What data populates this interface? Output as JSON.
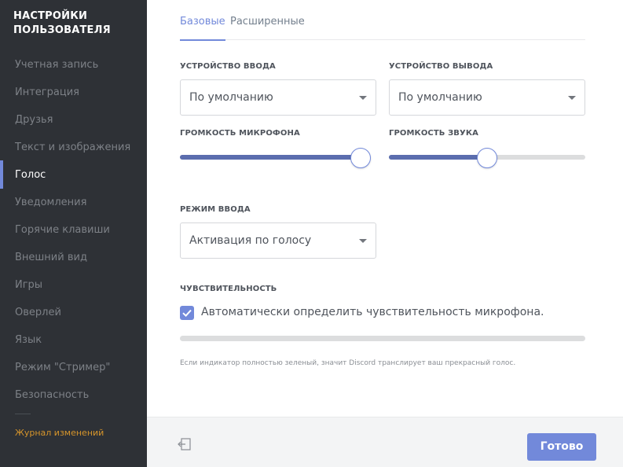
{
  "sidebar": {
    "title_line1": "НАСТРОЙКИ",
    "title_line2": "ПОЛЬЗОВАТЕЛЯ",
    "items": [
      {
        "label": "Учетная запись"
      },
      {
        "label": "Интеграция"
      },
      {
        "label": "Друзья"
      },
      {
        "label": "Текст и изображения"
      },
      {
        "label": "Голос"
      },
      {
        "label": "Уведомления"
      },
      {
        "label": "Горячие клавиши"
      },
      {
        "label": "Внешний вид"
      },
      {
        "label": "Игры"
      },
      {
        "label": "Оверлей"
      },
      {
        "label": "Язык"
      },
      {
        "label": "Режим \"Стример\""
      },
      {
        "label": "Безопасность"
      }
    ],
    "active_item": "Голос",
    "changelog_label": "Журнал изменений"
  },
  "tabs": [
    {
      "label": "Базовые",
      "active": true
    },
    {
      "label": "Расширенные",
      "active": false
    }
  ],
  "input_device": {
    "label": "УСТРОЙСТВО ВВОДА",
    "value": "По умолчанию"
  },
  "output_device": {
    "label": "УСТРОЙСТВО ВЫВОДА",
    "value": "По умолчанию"
  },
  "mic_volume": {
    "label": "ГРОМКОСТЬ МИКРОФОНА",
    "level": 0.96
  },
  "sound_volume": {
    "label": "ГРОМКОСТЬ ЗВУКА",
    "level": 0.5
  },
  "input_mode": {
    "label": "РЕЖИМ ВВОДА",
    "value": "Активация по голосу"
  },
  "sensitivity": {
    "label": "ЧУВСТВИТЕЛЬНОСТЬ",
    "auto_label": "Автоматически определить чувствительность микрофона.",
    "auto_checked": true,
    "hint": "Если индикатор полностью зеленый, значит Discord транслирует ваш прекрасный голос."
  },
  "footer": {
    "done_label": "Готово",
    "exit_icon": "exit-icon"
  },
  "colors": {
    "accent": "#7289da",
    "sidebar_bg": "#2e3136",
    "changelog": "#d6952b"
  }
}
